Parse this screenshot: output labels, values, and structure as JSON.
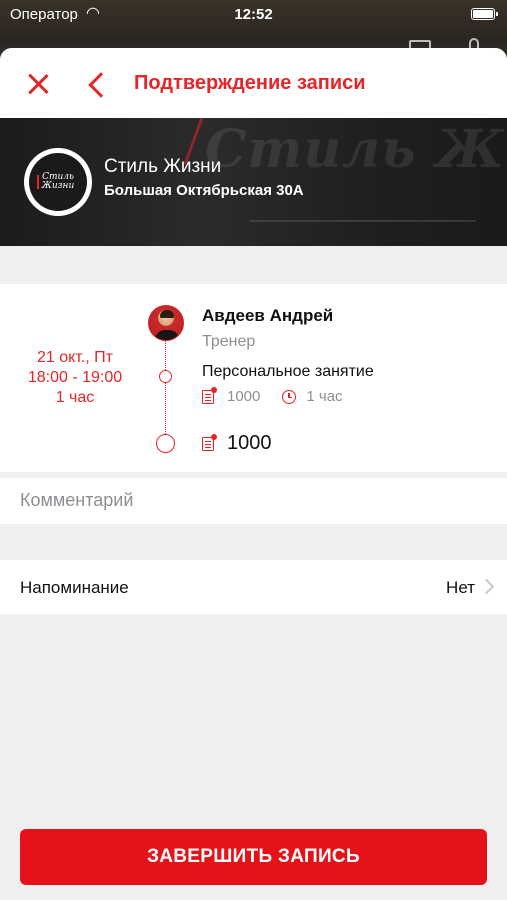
{
  "status_bar": {
    "carrier": "Оператор",
    "time": "12:52"
  },
  "nav": {
    "title": "Подтверждение записи"
  },
  "club": {
    "name": "Стиль Жизни",
    "address": "Большая Октябрьская 30А",
    "banner_text": "Стиль Жизни",
    "logo_text": "Стиль Жизни"
  },
  "booking": {
    "date": "21 окт., Пт",
    "time_range": "18:00 - 19:00",
    "duration": "1 час",
    "trainer_name": "Авдеев Андрей",
    "trainer_role": "Тренер",
    "service_name": "Персональное занятие",
    "service_price": "1000",
    "service_duration": "1 час",
    "total": "1000"
  },
  "comment": {
    "placeholder": "Комментарий"
  },
  "reminder": {
    "label": "Напоминание",
    "value": "Нет"
  },
  "submit": {
    "label": "ЗАВЕРШИТЬ ЗАПИСЬ"
  },
  "colors": {
    "accent": "#e52528",
    "button": "#e5121a",
    "background": "#efeff0"
  },
  "icons": [
    "close-icon",
    "back-icon",
    "price-tag-icon",
    "clock-icon",
    "chevron-right-icon",
    "wifi-icon",
    "battery-icon"
  ]
}
